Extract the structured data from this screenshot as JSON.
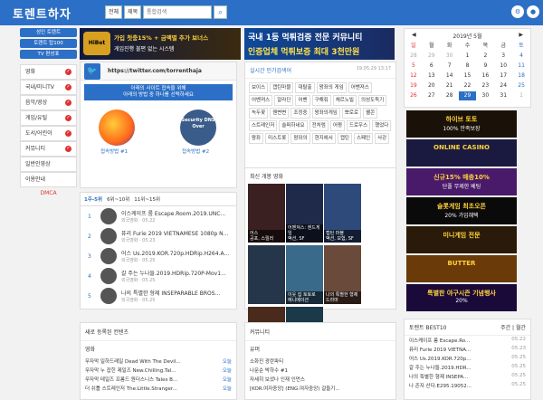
{
  "header": {
    "logo": "토렌트하자",
    "search_opt1": "전체",
    "search_opt2": "제목",
    "search_placeholder": "통합검색"
  },
  "left_menu": {
    "buttons": [
      "성인 토렌트",
      "토렌트 탑100",
      "TV 편성표"
    ],
    "categories": [
      "영화",
      "국내/미니TV",
      "음악/영상",
      "게임/유틸",
      "도서/어린이",
      "커뮤니티",
      "일반인영상",
      "이용안내"
    ],
    "dmca": "DMCA"
  },
  "banners": {
    "b1_line1": "가입 첫충15% + 금액별 추가 보너스",
    "b1_line2": "게임진행 불편 없는 시스템",
    "b2_line1": "국내 1등 먹튀검증 전문 커뮤니티",
    "b2_line2": "인증업체 먹튀보증 최대 3천만원"
  },
  "twitter": {
    "url": "https://twitter.com/torrenthaja",
    "notice_line1": "아래의 사이트 접속을 위해",
    "notice_line2": "아래의 방법 중 하나를 선택하세요",
    "cap1": "접속방법 #1",
    "cap2": "접속방법 #2",
    "dns_label": "Security DNS Over"
  },
  "ranking": {
    "title": "실시간 인기검색어",
    "date": "19.05.29 13:17",
    "tags": [
      "보이스",
      "캡틴마블",
      "대탈출",
      "왕좌의 게임",
      "어벤져스",
      "어벤져스",
      "알라딘",
      "어벤",
      "구해줘",
      "체르노빌",
      "의성도둑기",
      "녹두꽃",
      "웬변변",
      "조정중",
      "왕좌의게임",
      "뽀로로",
      "웰콘",
      "스트레인저",
      "슬퍼하네요",
      "전처럼",
      "어쩡",
      "드로우스",
      "했었다",
      "왕좌",
      "미스트롯",
      "왕좌의",
      "현지에서",
      "캡틴",
      "스페인",
      "사강"
    ]
  },
  "popular": {
    "tabs": [
      "1주-5위",
      "6위~10위",
      "11위~15위"
    ],
    "rows": [
      {
        "n": "1",
        "title": "이스케이프 룸 Escape.Room.2019.UNC...",
        "meta": "외국영화 · 05.22"
      },
      {
        "n": "2",
        "title": "퓨리 Furie 2019 VIETNAMESE 1080p N...",
        "meta": "외국영화 · 05.23"
      },
      {
        "n": "3",
        "title": "어스 Us.2019.KOR.720p.HDRip.H264.A...",
        "meta": "외국영화 · 05.25"
      },
      {
        "n": "4",
        "title": "갈 주는 누나들.2019.HDRip.720P-Mov1...",
        "meta": "외국영화 · 05.25"
      },
      {
        "n": "5",
        "title": "나의 특별한 형제 INSEPARABLE BROS...",
        "meta": "외국영화 · 05.25"
      }
    ]
  },
  "movies": {
    "title": "최신 개봉 영화",
    "items": [
      {
        "t": "어스",
        "g": "공포, 스릴러"
      },
      {
        "t": "어벤져스: 엔드게임",
        "g": "액션, SF"
      },
      {
        "t": "캡틴 마블",
        "g": "액션, 모험, SF"
      },
      {
        "t": "",
        "g": ""
      },
      {
        "t": "이웃 집 토토로",
        "g": "애니메이션"
      },
      {
        "t": "나의 특별한 형제",
        "g": "드라마"
      },
      {
        "t": "사자",
        "g": "액션, 판타지"
      },
      {
        "t": "크래울",
        "g": "액션, 스릴러"
      }
    ]
  },
  "new_content": {
    "title": "새로 등록된 컨텐츠",
    "sub": "영화",
    "items": [
      {
        "t": "무자막 일하드레일 Dead With The Devil...",
        "r": "오늘"
      },
      {
        "t": "무자막 누 잡힌 제일즈 New.Chilling.Tal...",
        "r": "오늘"
      },
      {
        "t": "무자막 테일즈 프롬드 원더스니스 Tales B...",
        "r": "오늘"
      },
      {
        "t": "더 쉬틀 스트레인저 The.Little.Stranger...",
        "r": "오늘"
      }
    ]
  },
  "community": {
    "title": "커뮤니티",
    "sub": "유머",
    "items": [
      "소화진 광란파티",
      "나문순 박하수 #1",
      "자세히 보셨나 인재 인먼스",
      "[KOR.여자중앙] (ENG.여자중앙) 걸들기..."
    ]
  },
  "calendar": {
    "title": "2019년 5월",
    "days": [
      "일",
      "월",
      "화",
      "수",
      "목",
      "금",
      "토"
    ],
    "cells": [
      "28",
      "29",
      "30",
      "1",
      "2",
      "3",
      "4",
      "5",
      "6",
      "7",
      "8",
      "9",
      "10",
      "11",
      "12",
      "13",
      "14",
      "15",
      "16",
      "17",
      "18",
      "19",
      "20",
      "21",
      "22",
      "23",
      "24",
      "25",
      "26",
      "27",
      "28",
      "29",
      "30",
      "31",
      "1"
    ],
    "today": "29"
  },
  "ads": [
    {
      "t1": "하이브 토토",
      "t2": "100% 만족보장"
    },
    {
      "t1": "ONLINE CASINO",
      "t2": ""
    },
    {
      "t1": "신규15% 매충10%",
      "t2": "단폴 무제한 베팅"
    },
    {
      "t1": "슬롯게임 최초오픈",
      "t2": "20% 가입혜택"
    },
    {
      "t1": "미니게임 전문",
      "t2": ""
    },
    {
      "t1": "BUTTER",
      "t2": ""
    },
    {
      "t1": "특별한 야구시즌 기념행사",
      "t2": "20%"
    }
  ],
  "best": {
    "title": "토렌트 BEST10",
    "tab1": "주간",
    "tab2": "월간",
    "items": [
      {
        "t": "이스케이프 룸 Escape.Ro...",
        "d": "05.22"
      },
      {
        "t": "퓨리 Furie 2019 VIETNA...",
        "d": "05.23"
      },
      {
        "t": "어스 Us.2019.KOR.720p...",
        "d": "05.25"
      },
      {
        "t": "갈 주는 누나들.2019.HDR...",
        "d": "05.25"
      },
      {
        "t": "나의 특별한 형제 INSEPA...",
        "d": "05.25"
      },
      {
        "t": "나 존자 산다.E295.19052...",
        "d": "05.25"
      }
    ]
  },
  "colors": {
    "accent": "#2c6fc6",
    "check": "#e03030"
  }
}
